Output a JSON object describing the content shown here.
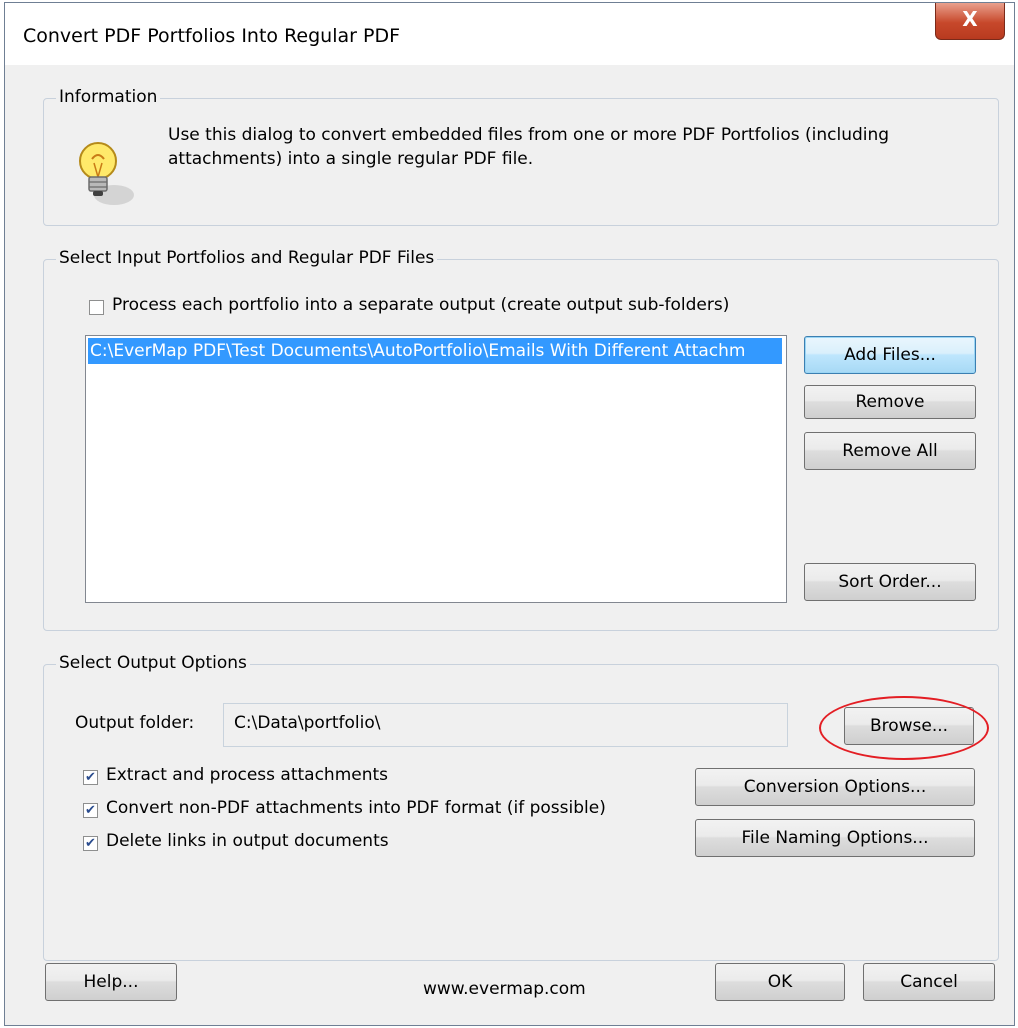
{
  "window": {
    "title": "Convert PDF Portfolios Into Regular PDF",
    "close_label": "X"
  },
  "information": {
    "group_label": "Information",
    "icon": "lightbulb-icon",
    "text_line1": "Use this dialog to convert embedded files from one or more PDF Portfolios (including",
    "text_line2": "attachments) into a single regular PDF file."
  },
  "input": {
    "group_label": "Select Input Portfolios and Regular PDF Files",
    "separate_output_label": "Process each portfolio into a separate output (create output sub-folders)",
    "separate_output_checked": false,
    "files": [
      "C:\\EverMap PDF\\Test Documents\\AutoPortfolio\\Emails With Different Attachm"
    ],
    "add_files_label": "Add Files...",
    "remove_label": "Remove",
    "remove_all_label": "Remove All",
    "sort_order_label": "Sort Order..."
  },
  "output": {
    "group_label": "Select Output Options",
    "folder_label": "Output folder:",
    "folder_value": "C:\\Data\\portfolio\\",
    "browse_label": "Browse...",
    "extract_label": "Extract and process attachments",
    "extract_checked": true,
    "convert_label": "Convert non-PDF attachments into PDF format (if possible)",
    "convert_checked": true,
    "delete_links_label": "Delete links in output documents",
    "delete_links_checked": true,
    "conversion_options_label": "Conversion Options...",
    "file_naming_options_label": "File Naming Options..."
  },
  "footer": {
    "help_label": "Help...",
    "website": "www.evermap.com",
    "ok_label": "OK",
    "cancel_label": "Cancel"
  },
  "colors": {
    "selection": "#3399ff",
    "highlight_circle": "#e31e24",
    "dialog_bg": "#f0f0f0"
  }
}
